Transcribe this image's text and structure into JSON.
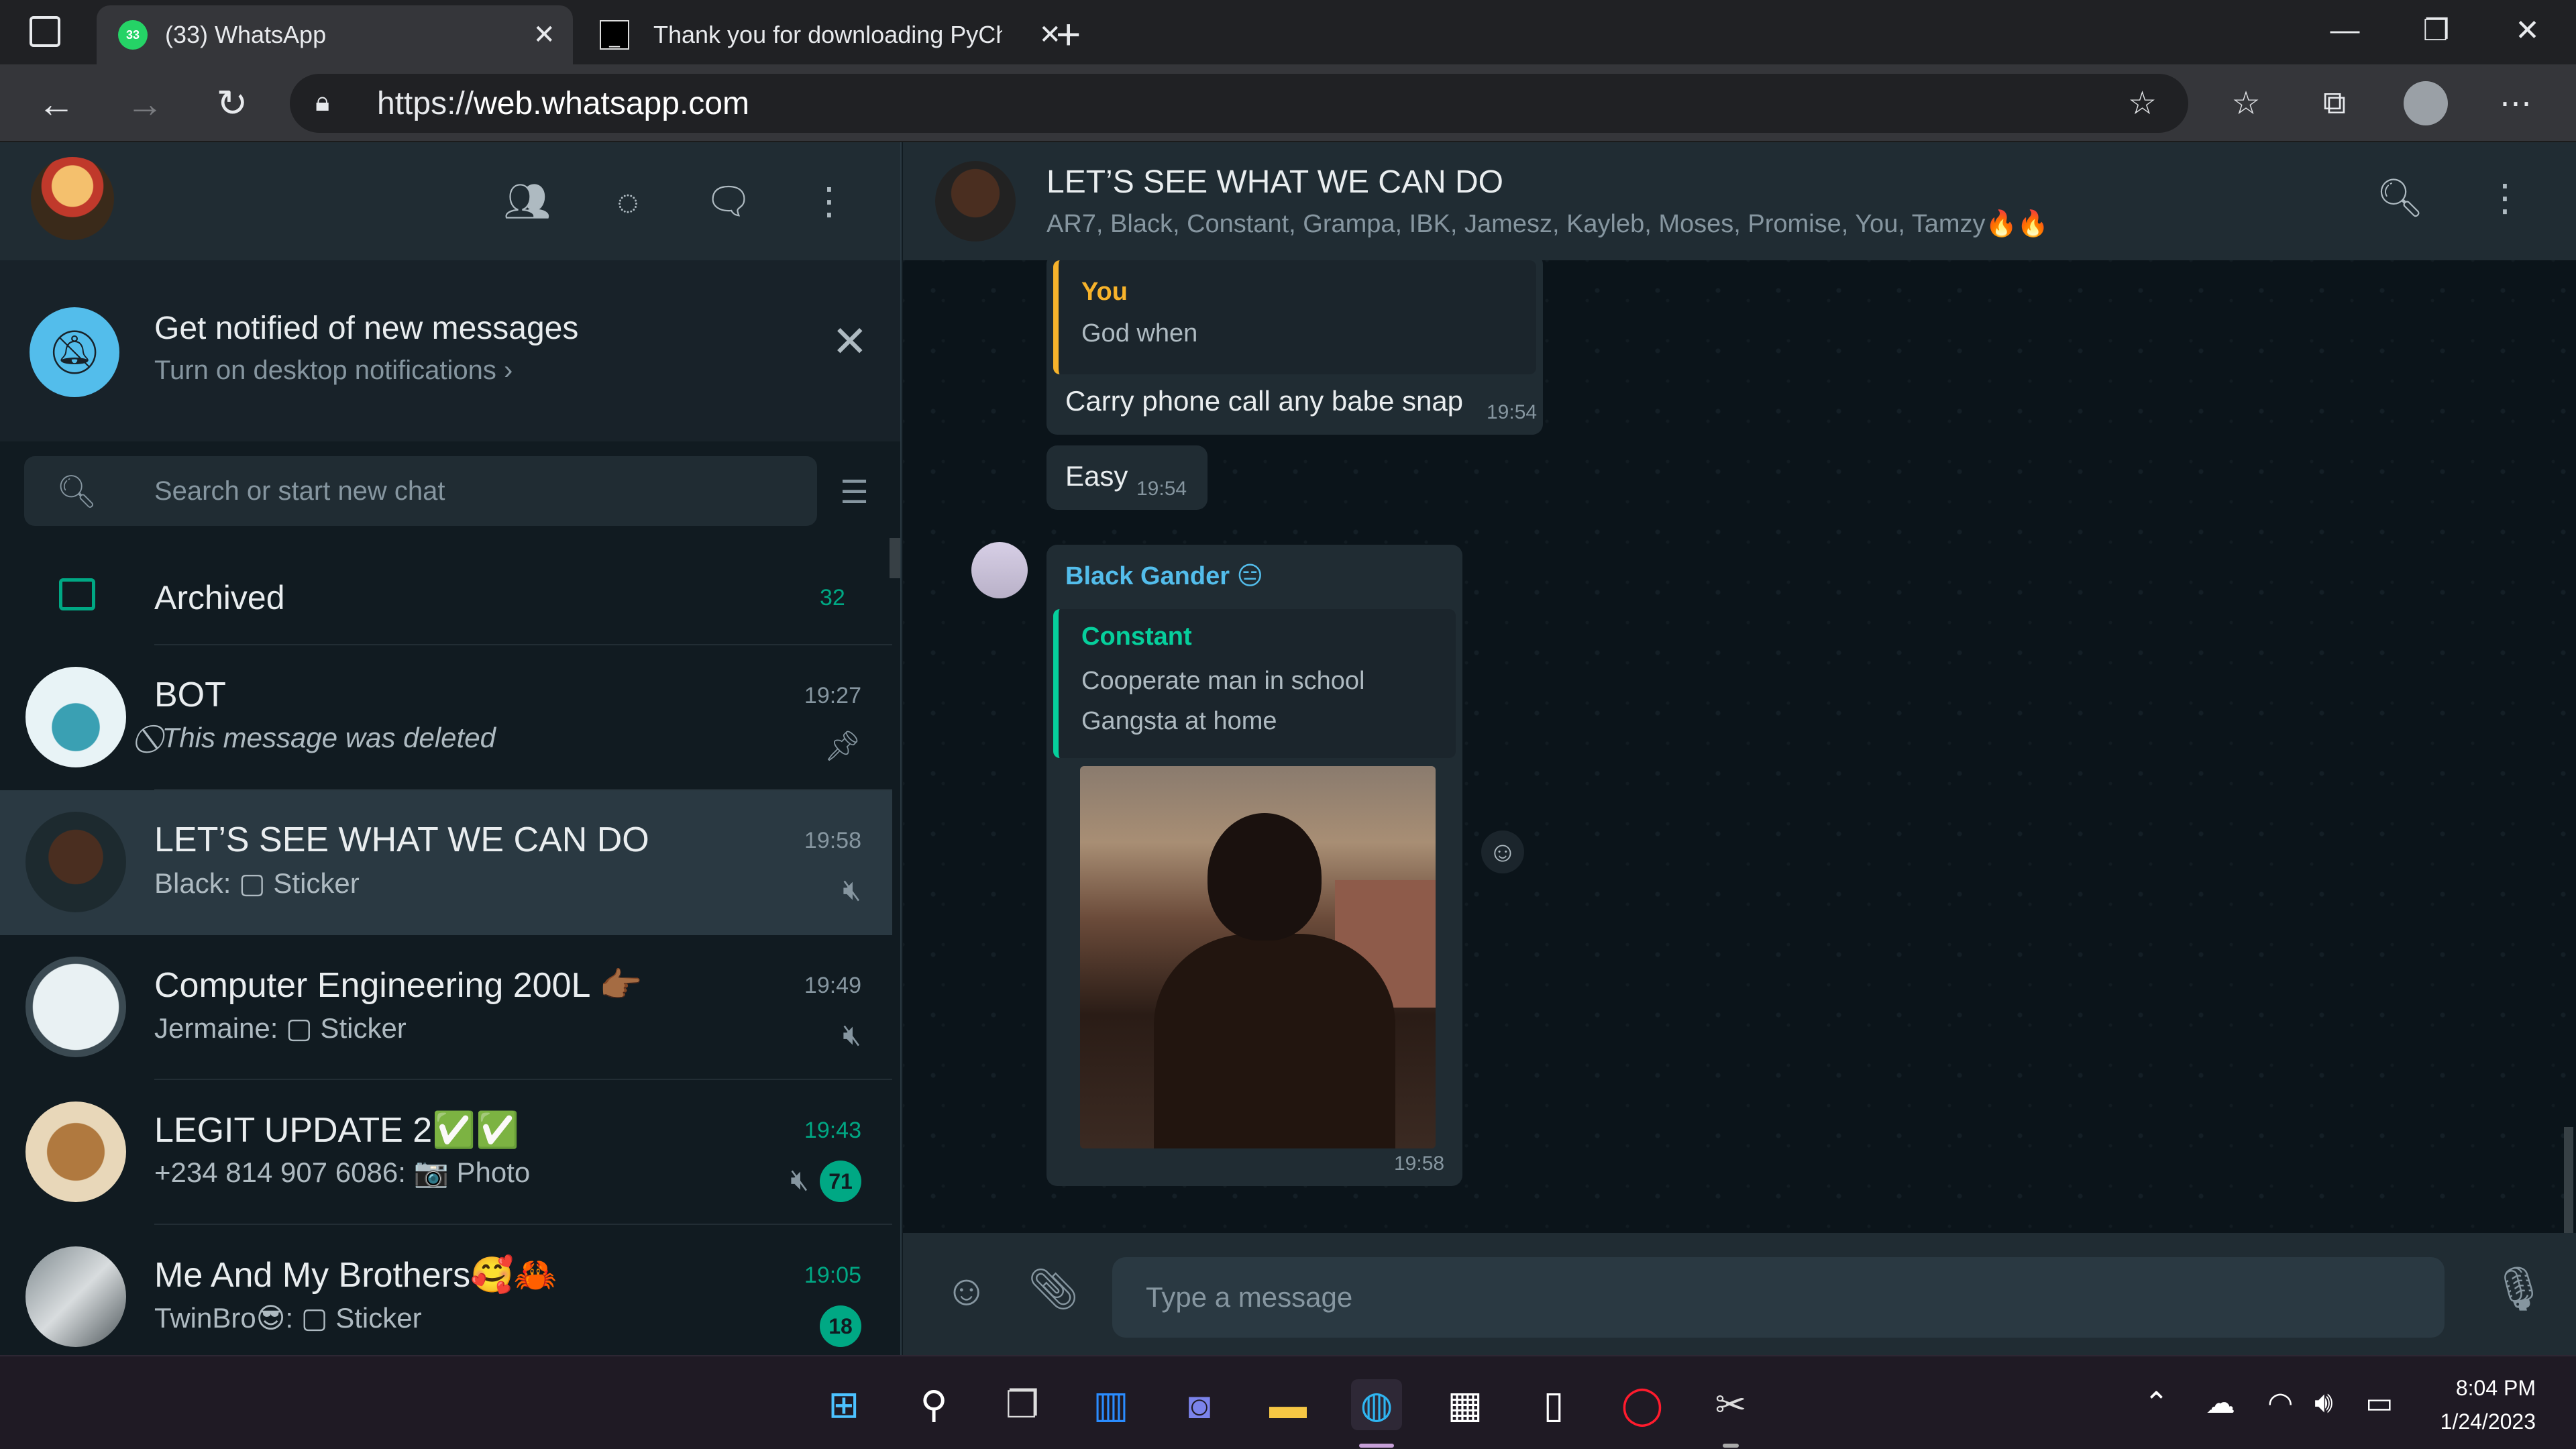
{
  "browser": {
    "tabs": [
      {
        "title": "(33) WhatsApp",
        "favicon_badge": "33"
      },
      {
        "title": "Thank you for downloading PyCh"
      }
    ],
    "new_tab": "+",
    "url_scheme": "https://",
    "url_host": "web.whatsapp.com",
    "window_controls": {
      "minimize": "—",
      "maximize": "❐",
      "close": "✕"
    }
  },
  "left_header": {
    "icons": [
      "community-icon",
      "status-icon",
      "new-chat-icon",
      "menu-icon"
    ]
  },
  "notification": {
    "title": "Get notified of new messages",
    "subtitle": "Turn on desktop notifications ›"
  },
  "search": {
    "placeholder": "Search or start new chat"
  },
  "archived": {
    "label": "Archived",
    "count": "32"
  },
  "chats": [
    {
      "name": "BOT",
      "last": "This message was deleted",
      "time": "19:27",
      "status": "pinned"
    },
    {
      "name": "LET’S SEE WHAT WE CAN DO",
      "last": "Black: ▢ Sticker",
      "time": "19:58",
      "status": "muted",
      "active": true
    },
    {
      "name": "Computer Engineering 200L 👉🏾",
      "last": "Jermaine: ▢ Sticker",
      "time": "19:49",
      "status": "muted"
    },
    {
      "name": "LEGIT UPDATE 2✅✅",
      "last": "+234 814 907 6086: 📷 Photo",
      "time": "19:43",
      "unread": "71",
      "status": "muted"
    },
    {
      "name": "Me And My Brothers🥰🦀",
      "last": "TwinBro😎: ▢ Sticker",
      "time": "19:05",
      "unread": "18"
    }
  ],
  "conversation": {
    "title": "LET’S SEE WHAT WE CAN DO",
    "members": "AR7, Black, Constant, Grampa, IBK, Jamesz, Kayleb, Moses, Promise, You, Tamzy🔥🔥",
    "messages": [
      {
        "quote_author": "You",
        "quote_text": "God when",
        "text": "Carry phone call any babe snap",
        "time": "19:54"
      },
      {
        "text": "Easy",
        "time": "19:54"
      },
      {
        "sender": "Black Gander 😑",
        "quote_author": "Constant",
        "quote_lines": [
          "Cooperate man in school",
          "Gangsta at home"
        ],
        "attachment": "image",
        "time": "19:58"
      }
    ],
    "composer_placeholder": "Type a message"
  },
  "taskbar": {
    "apps": [
      "windows-start",
      "search",
      "task-view",
      "widgets",
      "teams-chat",
      "file-explorer",
      "edge",
      "store",
      "notepad",
      "opera",
      "snipping"
    ],
    "clock_time": "8:04 PM",
    "clock_date": "1/24/2023"
  },
  "colors": {
    "accent": "#00a884",
    "panel": "#202c33",
    "background": "#111b21",
    "you_quote": "#f7b32b",
    "constant_quote": "#06cf9c",
    "sender_name": "#53bdeb"
  }
}
